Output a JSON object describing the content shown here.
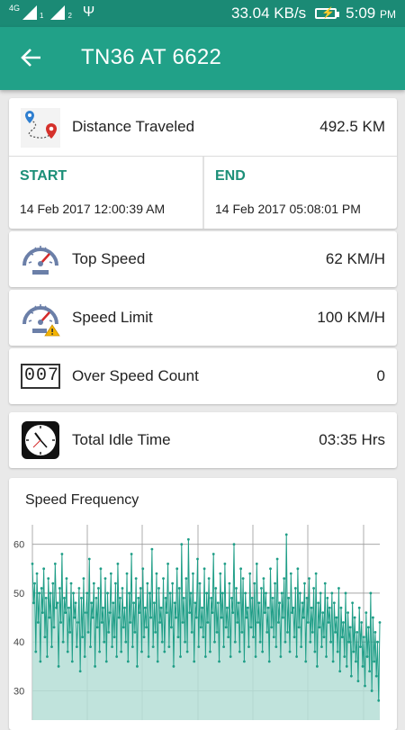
{
  "status_bar": {
    "network": "4G",
    "sim1": "1",
    "sim2": "2",
    "speed": "33.04 KB/s",
    "time": "5:09",
    "ampm": "PM"
  },
  "header": {
    "title": "TN36 AT 6622"
  },
  "distance": {
    "label": "Distance Traveled",
    "value": "492.5 KM"
  },
  "start": {
    "label": "START",
    "datetime": "14 Feb 2017 12:00:39 AM"
  },
  "end": {
    "label": "END",
    "datetime": "14 Feb 2017 05:08:01 PM"
  },
  "top_speed": {
    "label": "Top Speed",
    "value": "62 KM/H"
  },
  "speed_limit": {
    "label": "Speed Limit",
    "value": "100 KM/H"
  },
  "over_speed": {
    "label": "Over Speed Count",
    "value": "0",
    "counter_digits": "007"
  },
  "idle": {
    "label": "Total Idle Time",
    "value": "03:35 Hrs"
  },
  "chart_data": {
    "type": "area",
    "title": "Speed Frequency",
    "xlabel": "",
    "ylabel": "",
    "y_ticks": [
      30,
      40,
      50,
      60
    ],
    "ylim": [
      24,
      64
    ],
    "grid": true,
    "line_color": "#1f9e87",
    "fill_color": "#b5ded6",
    "values": [
      56,
      48,
      52,
      38,
      54,
      44,
      50,
      36,
      51,
      46,
      55,
      41,
      49,
      37,
      53,
      45,
      50,
      39,
      52,
      43,
      56,
      47,
      48,
      35,
      51,
      44,
      58,
      40,
      49,
      46,
      53,
      38,
      47,
      42,
      52,
      36,
      50,
      45,
      48,
      39,
      44,
      51,
      34,
      49,
      41,
      53,
      37,
      46,
      50,
      42,
      57,
      39,
      48,
      45,
      52,
      35,
      49,
      43,
      51,
      38,
      55,
      44,
      47,
      40,
      53,
      36,
      50,
      42,
      46,
      54,
      39,
      48,
      41,
      52,
      37,
      56,
      45,
      49,
      38,
      51,
      43,
      47,
      40,
      54,
      36,
      50,
      44,
      58,
      39,
      48,
      42,
      53,
      35,
      49,
      46,
      51,
      38,
      55,
      41,
      47,
      43,
      52,
      37,
      50,
      45,
      59,
      39,
      48,
      42,
      54,
      36,
      51,
      44,
      47,
      40,
      53,
      38,
      49,
      46,
      56,
      39,
      50,
      43,
      52,
      35,
      48,
      45,
      55,
      41,
      51,
      37,
      60,
      44,
      49,
      40,
      53,
      38,
      61,
      46,
      50,
      42,
      54,
      36,
      48,
      45,
      57,
      39,
      52,
      43,
      47,
      41,
      55,
      37,
      50,
      44,
      53,
      38,
      49,
      46,
      58,
      40,
      51,
      42,
      48,
      36,
      54,
      45,
      50,
      39,
      56,
      43,
      47,
      41,
      52,
      37,
      49,
      46,
      60,
      40,
      51,
      44,
      48,
      38,
      55,
      42,
      53,
      36,
      50,
      45,
      47,
      39,
      54,
      43,
      49,
      41,
      52,
      37,
      56,
      44,
      48,
      40,
      51,
      38,
      53,
      46,
      50,
      42,
      47,
      36,
      55,
      43,
      49,
      41,
      52,
      39,
      57,
      44,
      48,
      37,
      50,
      45,
      53,
      40,
      62,
      42,
      49,
      38,
      54,
      46,
      47,
      41,
      51,
      37,
      55,
      43,
      50,
      39,
      48,
      45,
      52,
      36,
      49,
      44,
      53,
      40,
      47,
      42,
      51,
      38,
      54,
      35,
      48,
      43,
      50,
      39,
      46,
      41,
      52,
      37,
      49,
      44,
      47,
      40,
      50,
      36,
      48,
      42,
      45,
      38,
      51,
      34,
      47,
      41,
      44,
      37,
      50,
      35,
      46,
      40,
      43,
      33,
      48,
      38,
      45,
      36,
      42,
      32,
      47,
      39,
      44,
      35,
      41,
      31,
      46,
      37,
      43,
      34,
      50,
      30,
      45,
      36,
      42,
      33,
      40,
      28,
      44
    ]
  }
}
